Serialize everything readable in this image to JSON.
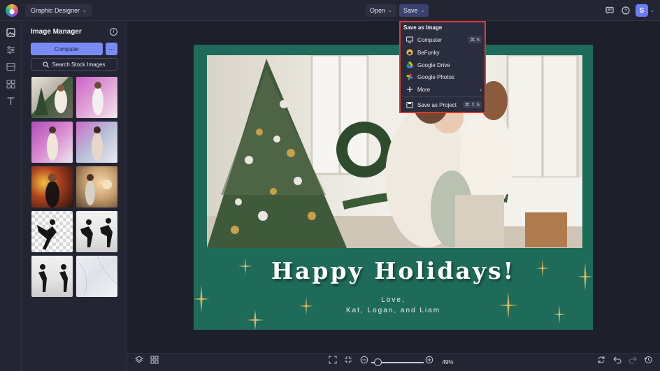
{
  "topbar": {
    "app_name": "Graphic Designer",
    "open_label": "Open",
    "save_label": "Save",
    "avatar_initial": "S"
  },
  "panel": {
    "title": "Image Manager",
    "computer_button": "Computer",
    "more_button": "···",
    "search_button": "Search Stock Images"
  },
  "save_menu": {
    "heading": "Save as Image",
    "items": [
      {
        "label": "Computer",
        "shortcut": "⌘ S",
        "icon": "monitor-icon"
      },
      {
        "label": "BeFunky",
        "shortcut": "",
        "icon": "befunky-icon"
      },
      {
        "label": "Google Drive",
        "shortcut": "",
        "icon": "google-drive-icon"
      },
      {
        "label": "Google Photos",
        "shortcut": "",
        "icon": "google-photos-icon"
      },
      {
        "label": "More",
        "shortcut": "",
        "icon": "plus-icon"
      },
      {
        "label": "Save as Project",
        "shortcut": "⌘ ⇧ S",
        "icon": "project-icon"
      }
    ]
  },
  "card": {
    "headline": "Happy Holidays!",
    "line1": "Love,",
    "line2": "Kat, Logan, and Liam"
  },
  "bottombar": {
    "zoom_value": "49%",
    "zoom_level": 0.49
  },
  "colors": {
    "accent": "#7b8bf6",
    "card_green": "#1f6b5a",
    "highlight_red": "#e0382b",
    "sparkle_gold": "#d8b860"
  }
}
